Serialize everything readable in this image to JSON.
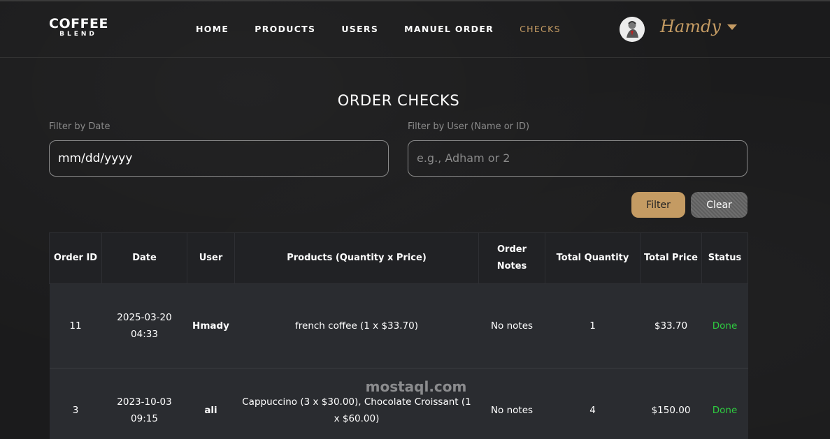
{
  "brand": {
    "name": "COFFEE",
    "sub": "BLEND"
  },
  "nav": {
    "items": [
      {
        "label": "HOME"
      },
      {
        "label": "PRODUCTS"
      },
      {
        "label": "USERS"
      },
      {
        "label": "MANUEL ORDER"
      },
      {
        "label": "CHECKS",
        "active": true
      }
    ]
  },
  "user": {
    "name": "Hamdy"
  },
  "page": {
    "title": "ORDER CHECKS"
  },
  "filters": {
    "date_label": "Filter by Date",
    "date_value": "mm/dd/yyyy",
    "user_label": "Filter by User (Name or ID)",
    "user_placeholder": "e.g., Adham or 2",
    "filter_button": "Filter",
    "clear_button": "Clear"
  },
  "table": {
    "headers": [
      "Order ID",
      "Date",
      "User",
      "Products (Quantity x Price)",
      "Order Notes",
      "Total Quantity",
      "Total Price",
      "Status"
    ],
    "rows": [
      {
        "order_id": "11",
        "date": "2025-03-20",
        "time": "04:33",
        "user": "Hmady",
        "products": "french coffee (1 x $33.70)",
        "notes": "No notes",
        "total_quantity": "1",
        "total_price": "$33.70",
        "status": "Done"
      },
      {
        "order_id": "3",
        "date": "2023-10-03",
        "time": "09:15",
        "user": "ali",
        "products": "Cappuccino (3 x $30.00), Chocolate Croissant (1 x $60.00)",
        "notes": "No notes",
        "total_quantity": "4",
        "total_price": "$150.00",
        "status": "Done"
      }
    ]
  },
  "watermark": "mostaql.com",
  "colors": {
    "accent": "#c49b63",
    "status_done": "#2ecc40",
    "background": "#1b1b1c"
  }
}
